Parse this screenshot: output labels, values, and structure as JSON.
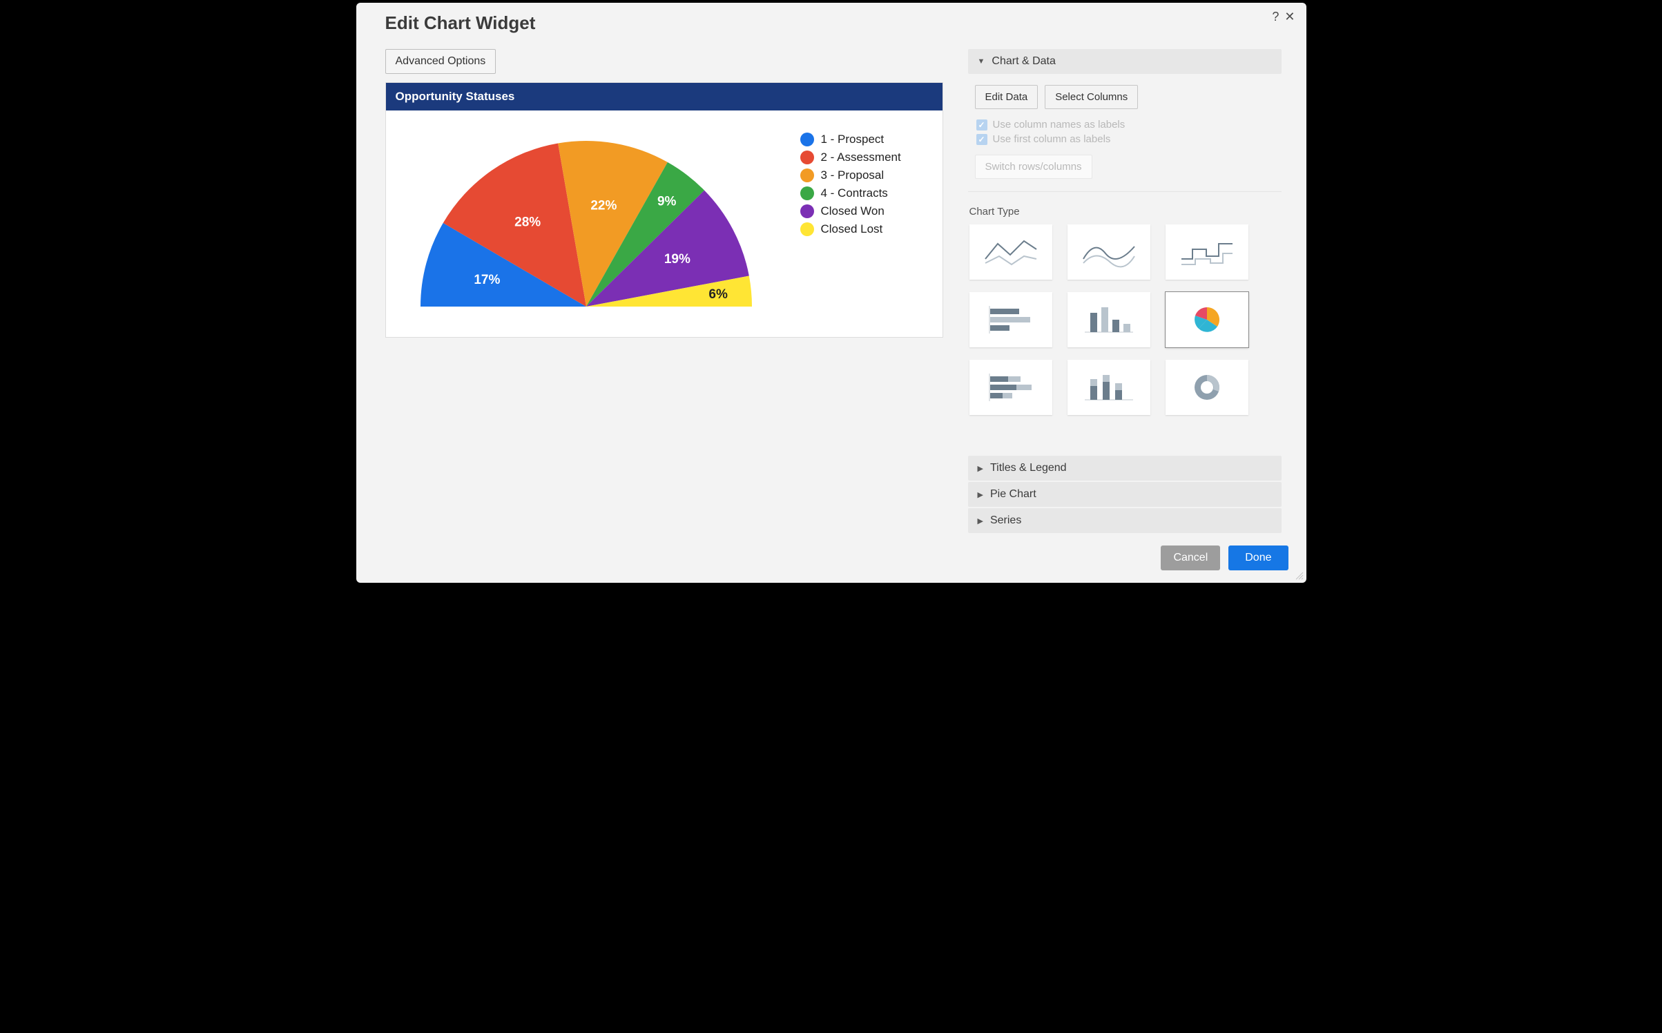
{
  "dialog": {
    "title": "Edit Chart Widget",
    "advanced_options": "Advanced Options",
    "cancel": "Cancel",
    "done": "Done"
  },
  "chart": {
    "title": "Opportunity Statuses"
  },
  "chart_data": {
    "type": "pie",
    "variant": "half-donut",
    "title": "Opportunity Statuses",
    "categories": [
      "1 - Prospect",
      "2 - Assessment",
      "3 - Proposal",
      "4 - Contracts",
      "Closed Won",
      "Closed Lost"
    ],
    "values": [
      17,
      28,
      22,
      9,
      19,
      6
    ],
    "value_suffix": "%",
    "legend_position": "right",
    "colors": [
      "#1a73e8",
      "#e64a33",
      "#f29b24",
      "#3aa845",
      "#7b2fb4",
      "#ffe534"
    ]
  },
  "panel": {
    "sections": {
      "chart_data": "Chart & Data",
      "titles_legend": "Titles & Legend",
      "pie_chart": "Pie Chart",
      "series": "Series"
    },
    "edit_data": "Edit Data",
    "select_columns": "Select Columns",
    "use_column_names": "Use column names as labels",
    "use_first_column": "Use first column as labels",
    "switch_rows_cols": "Switch rows/columns",
    "chart_type_label": "Chart Type",
    "chart_types": [
      {
        "id": "line",
        "selected": false
      },
      {
        "id": "spline",
        "selected": false
      },
      {
        "id": "step-line",
        "selected": false
      },
      {
        "id": "bar-h",
        "selected": false
      },
      {
        "id": "bar-v",
        "selected": false
      },
      {
        "id": "pie",
        "selected": true
      },
      {
        "id": "bar-h-stacked",
        "selected": false
      },
      {
        "id": "bar-v-stacked",
        "selected": false
      },
      {
        "id": "donut",
        "selected": false
      }
    ]
  }
}
